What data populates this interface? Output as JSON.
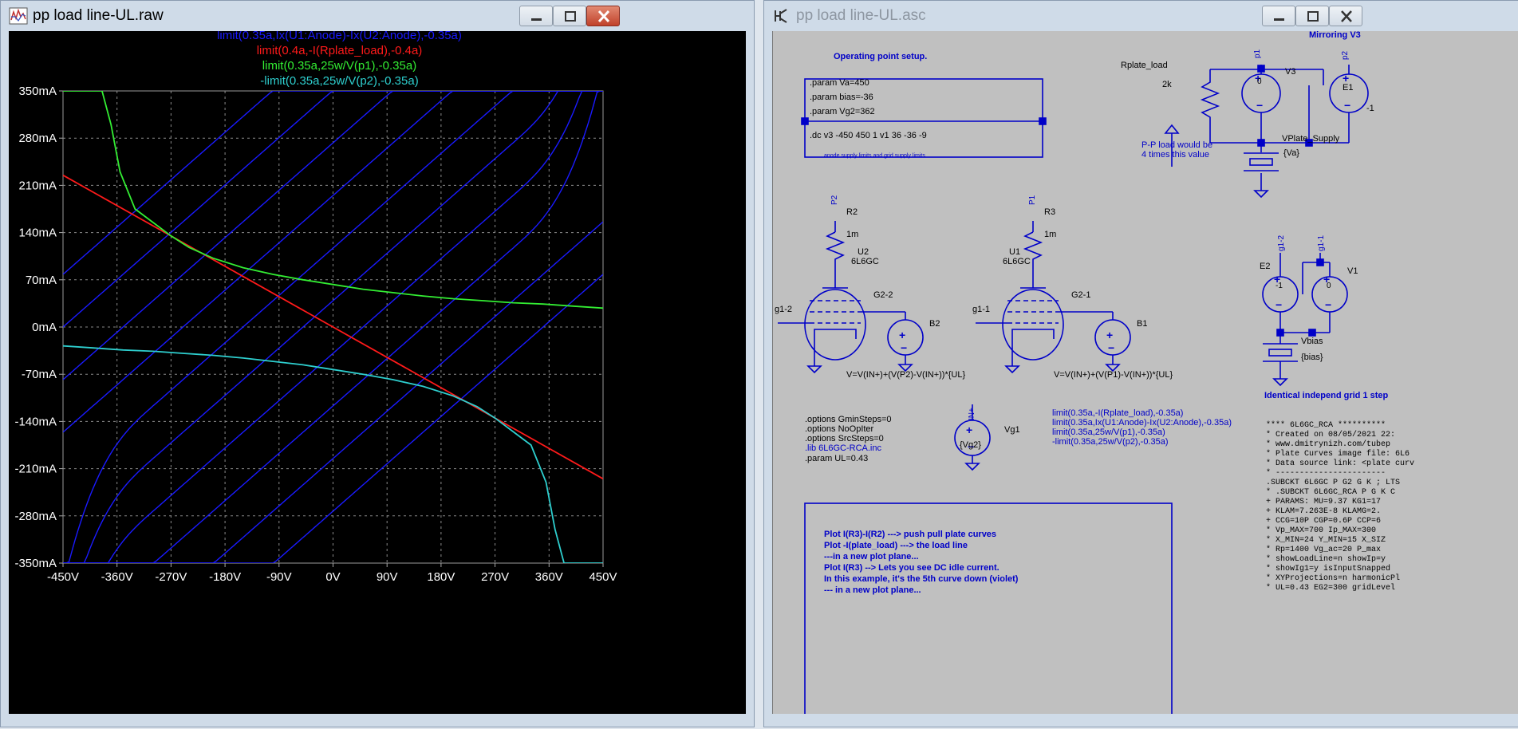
{
  "plot_window": {
    "title": "pp load line-UL.raw",
    "traces": [
      {
        "expr": "limit(0.35a,Ix(U1:Anode)-Ix(U2:Anode),-0.35a)",
        "color": "#1a1aff"
      },
      {
        "expr": "limit(0.4a,-I(Rplate_load),-0.4a)",
        "color": "#ff1a1a"
      },
      {
        "expr": "limit(0.35a,25w/V(p1),-0.35a)",
        "color": "#33ee33"
      },
      {
        "expr": "-limit(0.35a,25w/V(p2),-0.35a)",
        "color": "#2ecfcf"
      }
    ],
    "y_ticks": [
      "350mA",
      "280mA",
      "210mA",
      "140mA",
      "70mA",
      "0mA",
      "-70mA",
      "-140mA",
      "-210mA",
      "-280mA",
      "-350mA"
    ],
    "x_ticks": [
      "-450V",
      "-360V",
      "-270V",
      "-180V",
      "-90V",
      "0V",
      "90V",
      "180V",
      "270V",
      "360V",
      "450V"
    ]
  },
  "chart_data": {
    "type": "line",
    "xlabel": "",
    "ylabel": "",
    "xlim": [
      -450,
      450
    ],
    "ylim": [
      -350,
      350
    ],
    "x_unit": "V",
    "y_unit": "mA",
    "grid": true,
    "series": [
      {
        "name": "limit(0.35a,Ix(U1:Anode)-Ix(U2:Anode),-0.35a)",
        "color": "#1a1aff",
        "note_offsets_v": [
          -550,
          -450,
          -350,
          -250,
          -150,
          -50,
          50,
          150,
          250,
          350
        ]
      },
      {
        "name": "limit(0.4a,-I(Rplate_load),-0.4a)",
        "color": "#ff1a1a",
        "x": [
          -450,
          450
        ],
        "y": [
          225,
          -225
        ]
      },
      {
        "name": "limit(0.35a,25w/V(p1),-0.35a)",
        "color": "#33ee33",
        "x": [
          -450,
          -385,
          -370,
          -355,
          -330,
          -300,
          -270,
          -240,
          -200,
          -150,
          -100,
          -50,
          0,
          50,
          100,
          150,
          200,
          250,
          300,
          350,
          400,
          450
        ],
        "y": [
          350,
          350,
          300,
          230,
          175,
          155,
          135,
          118,
          102,
          88,
          78,
          70,
          63,
          56,
          51,
          46,
          42,
          39,
          36,
          34,
          31,
          28
        ]
      },
      {
        "name": "-limit(0.35a,25w/V(p2),-0.35a)",
        "color": "#2ecfcf",
        "x": [
          -450,
          -400,
          -350,
          -300,
          -250,
          -200,
          -150,
          -100,
          -50,
          0,
          50,
          100,
          150,
          200,
          240,
          270,
          300,
          330,
          355,
          370,
          385,
          450
        ],
        "y": [
          -28,
          -31,
          -34,
          -36,
          -39,
          -42,
          -46,
          -51,
          -56,
          -63,
          -70,
          -78,
          -88,
          -102,
          -118,
          -135,
          -155,
          -175,
          -230,
          -300,
          -350,
          -350
        ]
      }
    ]
  },
  "schematic_window": {
    "title": "pp load line-UL.asc",
    "op_setup_title": "Operating point setup.",
    "params": [
      ".param Va=450",
      ".param bias=-36",
      ".param Vg2=362"
    ],
    "dc_cmd": ".dc v3 -450 450 1 v1 36 -36 -9",
    "dc_note": "anode supply limits and grid supply limits",
    "rplate_label": "Rplate_load",
    "rplate_value": "2k",
    "pp_note_1": "P-P load would be",
    "pp_note_2": "4 times this value",
    "mirroring": "Mirroring V3",
    "v3": "V3",
    "e1": "E1",
    "e1_gain": "-1",
    "v3_val": "0",
    "vplate": "VPlate_Supply",
    "va": "{Va}",
    "p1": "p1",
    "p2": "p2",
    "P1": "P1",
    "P2": "P2",
    "r2": "R2",
    "r3": "R3",
    "r_val": "1m",
    "u2": "U2",
    "u1": "U1",
    "tube": "6L6GC",
    "g22": "G2-2",
    "g21": "G2-1",
    "g12": "g1-2",
    "g11": "g1-1",
    "b2": "B2",
    "b1": "B1",
    "expr_b2": "V=V(IN+)+(V(P2)-V(IN+))*{UL}",
    "expr_b1": "V=V(IN+)+(V(P1)-V(IN+))*{UL}",
    "e2": "E2",
    "v1": "V1",
    "e2_val": "-1",
    "v1_val": "0",
    "vbias": "Vbias",
    "bias": "{bias}",
    "identical": "Identical independ grid 1 step",
    "options": [
      ".options GminSteps=0",
      ".options NoOpIter",
      ".options SrcSteps=0",
      ".lib 6L6GC-RCA.inc",
      ".param UL=0.43"
    ],
    "in_plus": "IN+",
    "vg1": "Vg1",
    "vg2": "{Vg2}",
    "traces_text": [
      "limit(0.35a,-I(Rplate_load),-0.35a)",
      "limit(0.35a,Ix(U1:Anode)-Ix(U2:Anode),-0.35a)",
      "limit(0.35a,25w/V(p1),-0.35a)",
      "-limit(0.35a,25w/V(p2),-0.35a)"
    ],
    "model_lines": [
      "**** 6L6GC_RCA **********",
      "* Created on 08/05/2021 22:",
      "* www.dmitrynizh.com/tubep",
      "* Plate Curves image file: 6L6",
      "* Data source link: <plate curv",
      "* -----------------------",
      ".SUBCKT 6L6GC P G2 G K ; LTS",
      "* .SUBCKT 6L6GC_RCA P G K C",
      "+ PARAMS: MU=9.37 KG1=17",
      "+ KLAM=7.263E-8 KLAMG=2.",
      "+ CCG=10P CGP=0.6P CCP=6",
      "* Vp_MAX=700 Ip_MAX=300",
      "* X_MIN=24 Y_MIN=15 X_SIZ",
      "* Rp=1400 Vg_ac=20 P_max",
      "* showLoadLine=n showIp=y",
      "* showIg1=y isInputSnapped",
      "* XYProjections=n harmonicPl",
      "* UL=0.43 EG2=300 gridLevel"
    ],
    "plot_notes": [
      "Plot I(R3)-I(R2)     ---> push pull plate curves",
      "Plot -I(plate_load)   ---> the load line",
      "---in a new plot plane...",
      "Plot I(R3)    --> Lets you see DC idle current.",
      "   In this example, it's the 5th curve down (violet)",
      "--- in a new plot plane..."
    ]
  }
}
